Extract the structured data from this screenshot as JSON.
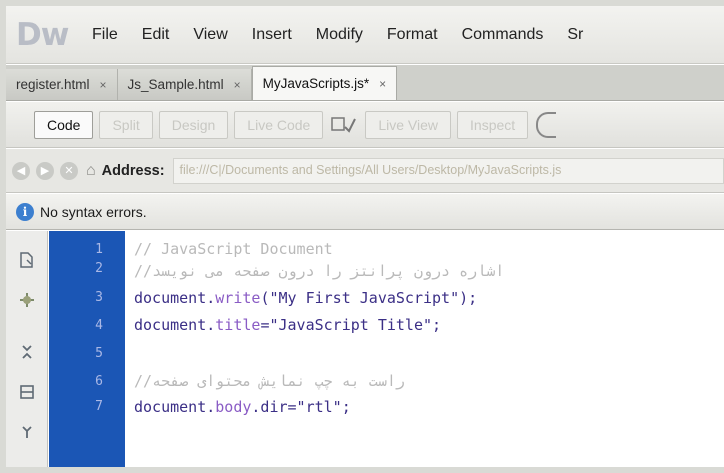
{
  "app": {
    "logo": "Dw"
  },
  "menu": [
    "File",
    "Edit",
    "View",
    "Insert",
    "Modify",
    "Format",
    "Commands",
    "Sr"
  ],
  "tabs": [
    {
      "label": "register.html",
      "close": "×"
    },
    {
      "label": "Js_Sample.html",
      "close": "×"
    },
    {
      "label": "MyJavaScripts.js*",
      "close": "×",
      "active": true
    }
  ],
  "toolbar": {
    "buttons": [
      "Code",
      "Split",
      "Design",
      "Live Code",
      "Live View",
      "Inspect"
    ]
  },
  "address": {
    "label": "Address:",
    "value": "file:///C|/Documents and Settings/All Users/Desktop/MyJavaScripts.js"
  },
  "status": {
    "message": "No syntax errors."
  },
  "editor": {
    "line_numbers": [
      "1",
      "2",
      "3",
      "4",
      "5",
      "6",
      "7"
    ],
    "lines": [
      {
        "comment": "// JavaScript Document"
      },
      {
        "comment": "//اشاره درون پرانتز را درون صفحه می نویسد"
      },
      {
        "obj": "document.",
        "method": "write",
        "rest": "(\"My First JavaScript\");"
      },
      {
        "obj": "document.",
        "method": "title",
        "rest": "=\"JavaScript Title\";"
      },
      {
        "comment": ""
      },
      {
        "comment": "//راست به چپ نمایش محتوای صفحه"
      },
      {
        "obj": "document.",
        "method": "body",
        "rest": ".dir=\"rtl\";"
      }
    ]
  },
  "colors": {
    "gutter": "#1b56b5",
    "accent": "#3c7fcf"
  }
}
